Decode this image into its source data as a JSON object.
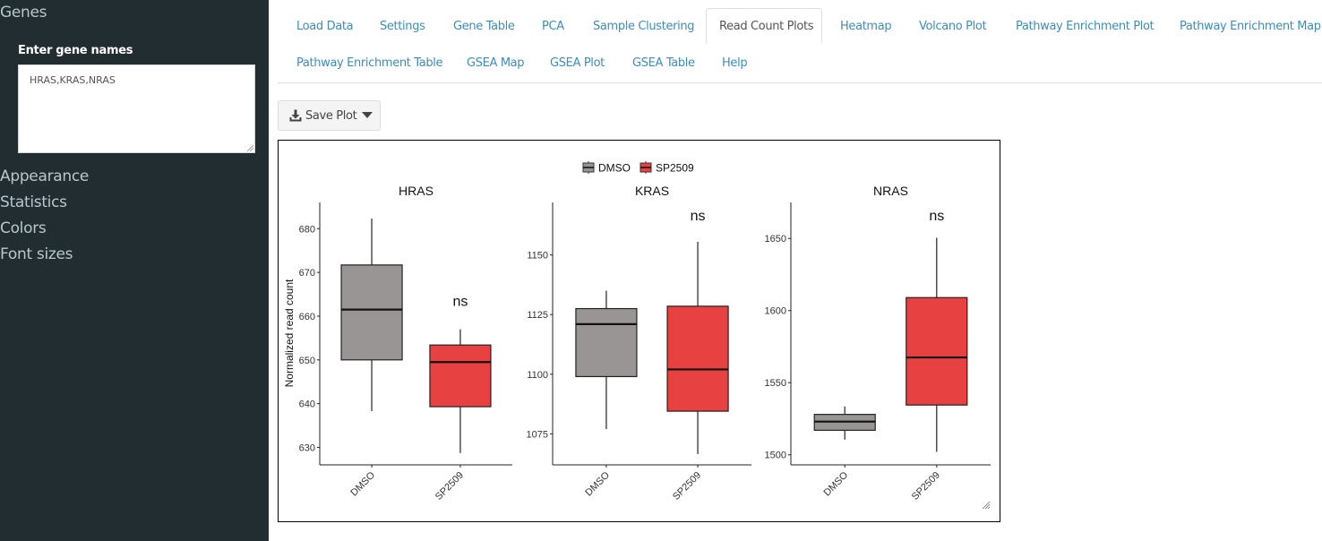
{
  "sidebar": {
    "sections": [
      {
        "label": "Genes"
      },
      {
        "label": "Appearance"
      },
      {
        "label": "Statistics"
      },
      {
        "label": "Colors"
      },
      {
        "label": "Font sizes"
      }
    ],
    "gene_input": {
      "label": "Enter gene names",
      "value": "HRAS,KRAS,NRAS"
    }
  },
  "tabs": [
    {
      "label": "Load Data"
    },
    {
      "label": "Settings"
    },
    {
      "label": "Gene Table"
    },
    {
      "label": "PCA"
    },
    {
      "label": "Sample Clustering"
    },
    {
      "label": "Read Count Plots",
      "active": true
    },
    {
      "label": "Heatmap"
    },
    {
      "label": "Volcano Plot"
    },
    {
      "label": "Pathway Enrichment Plot"
    },
    {
      "label": "Pathway Enrichment Map"
    },
    {
      "label": "Pathway Enrichment Table"
    },
    {
      "label": "GSEA Map"
    },
    {
      "label": "GSEA Plot"
    },
    {
      "label": "GSEA Table"
    },
    {
      "label": "Help"
    }
  ],
  "toolbar": {
    "save_label": "Save Plot",
    "save_icon": "download-icon",
    "dropdown_icon": "caret-down-icon"
  },
  "colors": {
    "sidebar_bg": "#222d32",
    "link": "#3c8dbc",
    "dmso": "#9a9595",
    "sp2509": "#e84142"
  },
  "chart_data": {
    "type": "boxplot",
    "ylabel": "Normalized read count",
    "legend": {
      "placement": "top-center",
      "entries": [
        {
          "name": "DMSO",
          "color": "#9a9595"
        },
        {
          "name": "SP2509",
          "color": "#e84142"
        }
      ]
    },
    "categories": [
      "DMSO",
      "SP2509"
    ],
    "panels": [
      {
        "title": "HRAS",
        "ylim": [
          626,
          686
        ],
        "yticks": [
          630,
          640,
          650,
          660,
          670,
          680
        ],
        "annotation": "ns",
        "boxes": [
          {
            "group": "DMSO",
            "min": 638.3,
            "q1": 650.0,
            "median": 661.5,
            "q3": 671.7,
            "max": 682.3
          },
          {
            "group": "SP2509",
            "min": 628.7,
            "q1": 639.3,
            "median": 649.5,
            "q3": 653.4,
            "max": 657.0
          }
        ]
      },
      {
        "title": "KRAS",
        "ylim": [
          1062,
          1172
        ],
        "yticks": [
          1075,
          1100,
          1125,
          1150
        ],
        "annotation": "ns",
        "boxes": [
          {
            "group": "DMSO",
            "min": 1077.0,
            "q1": 1099.0,
            "median": 1121.0,
            "q3": 1127.5,
            "max": 1135.0
          },
          {
            "group": "SP2509",
            "min": 1066.5,
            "q1": 1084.5,
            "median": 1102.0,
            "q3": 1128.5,
            "max": 1155.5
          }
        ]
      },
      {
        "title": "NRAS",
        "ylim": [
          1493,
          1675
        ],
        "yticks": [
          1500,
          1550,
          1600,
          1650
        ],
        "annotation": "ns",
        "boxes": [
          {
            "group": "DMSO",
            "min": 1510.5,
            "q1": 1517.0,
            "median": 1523.0,
            "q3": 1528.0,
            "max": 1533.5
          },
          {
            "group": "SP2509",
            "min": 1502.0,
            "q1": 1534.5,
            "median": 1567.5,
            "q3": 1609.0,
            "max": 1650.5
          }
        ]
      }
    ]
  }
}
